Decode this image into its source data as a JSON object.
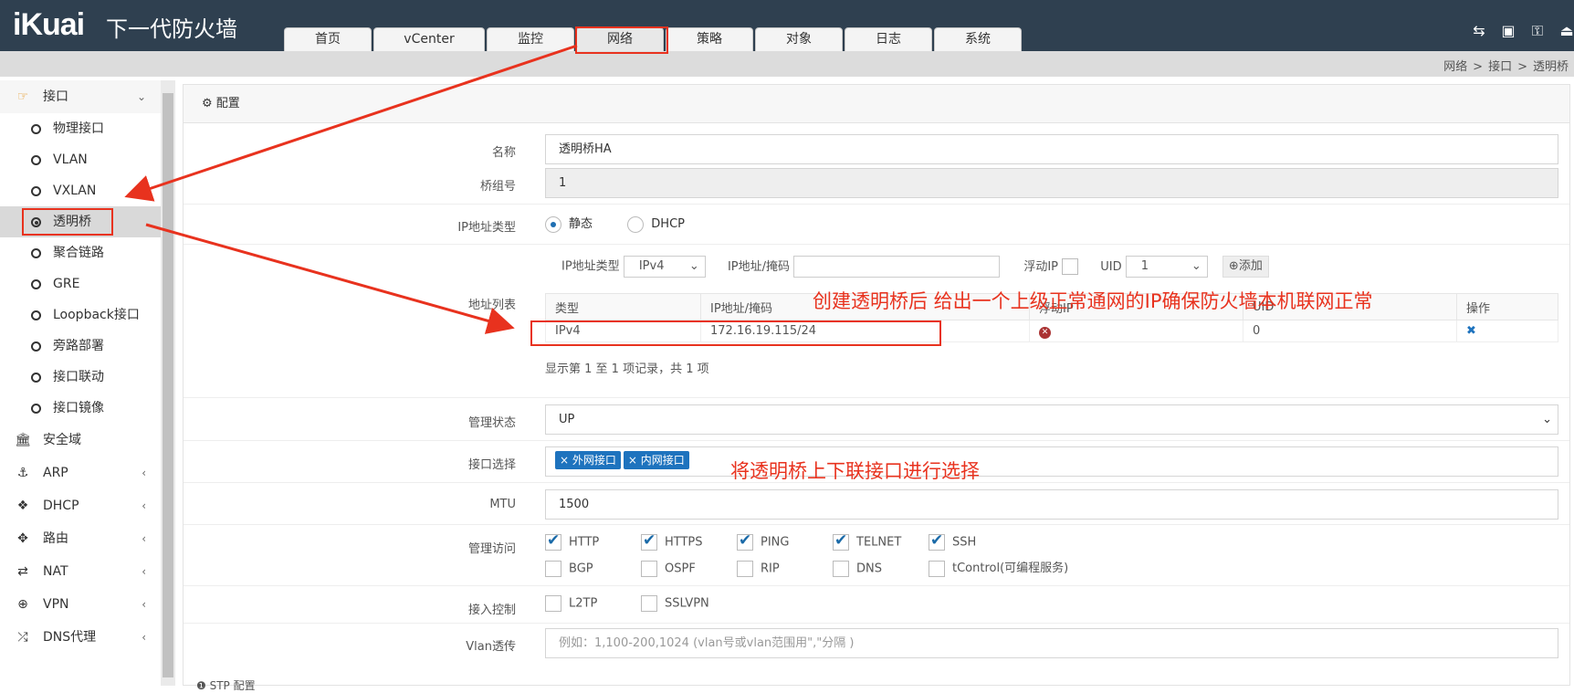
{
  "header": {
    "logo": "iKuai",
    "product": "下一代防火墙",
    "tabs": [
      "首页",
      "vCenter",
      "监控",
      "网络",
      "策略",
      "对象",
      "日志",
      "系统"
    ],
    "active_tab": "网络",
    "icons": [
      "translate-icon",
      "save-icon",
      "key-icon",
      "logout-icon"
    ]
  },
  "breadcrumb": [
    "网络",
    "接口",
    "透明桥"
  ],
  "breadcrumb_sep": ">",
  "sidebar": {
    "interface_group": "接口",
    "interface_items": [
      "物理接口",
      "VLAN",
      "VXLAN",
      "透明桥",
      "聚合链路",
      "GRE",
      "Loopback接口",
      "旁路部署",
      "接口联动",
      "接口镜像"
    ],
    "active_item": "透明桥",
    "groups": [
      {
        "label": "安全域",
        "icon": "bank-icon"
      },
      {
        "label": "ARP",
        "icon": "arp-icon"
      },
      {
        "label": "DHCP",
        "icon": "dhcp-icon"
      },
      {
        "label": "路由",
        "icon": "route-icon"
      },
      {
        "label": "NAT",
        "icon": "nat-icon"
      },
      {
        "label": "VPN",
        "icon": "vpn-icon"
      },
      {
        "label": "DNS代理",
        "icon": "shuffle-icon"
      }
    ]
  },
  "panel": {
    "title": "配置",
    "name_label": "名称",
    "name_value": "透明桥HA",
    "bridge_group_label": "桥组号",
    "bridge_group_value": "1",
    "ip_type_label": "IP地址类型",
    "ip_type_static": "静态",
    "ip_type_dhcp": "DHCP",
    "addr_row": {
      "ip_type_label": "IP地址类型",
      "ip_type_value": "IPv4",
      "ip_mask_label": "IP地址/掩码",
      "floating_label": "浮动IP",
      "uid_label": "UID",
      "uid_value": "1",
      "add_label": "添加"
    },
    "addr_list_label": "地址列表",
    "table": {
      "headers": [
        "类型",
        "IP地址/掩码",
        "浮动IP",
        "UID",
        "操作"
      ],
      "rows": [
        [
          "IPv4",
          "172.16.19.115/24",
          "",
          "0",
          ""
        ]
      ],
      "footer": "显示第 1 至 1 项记录，共 1 项"
    },
    "admin_state_label": "管理状态",
    "admin_state_value": "UP",
    "iface_select_label": "接口选择",
    "iface_tags": [
      "外网接口",
      "内网接口"
    ],
    "mtu_label": "MTU",
    "mtu_value": "1500",
    "mgmt_label": "管理访问",
    "mgmt_row1": [
      {
        "label": "HTTP",
        "checked": true
      },
      {
        "label": "HTTPS",
        "checked": true
      },
      {
        "label": "PING",
        "checked": true
      },
      {
        "label": "TELNET",
        "checked": true
      },
      {
        "label": "SSH",
        "checked": true
      }
    ],
    "mgmt_row2": [
      {
        "label": "BGP",
        "checked": false
      },
      {
        "label": "OSPF",
        "checked": false
      },
      {
        "label": "RIP",
        "checked": false
      },
      {
        "label": "DNS",
        "checked": false
      },
      {
        "label": "tControl(可编程服务)",
        "checked": false
      }
    ],
    "access_label": "接入控制",
    "access_items": [
      {
        "label": "L2TP",
        "checked": false
      },
      {
        "label": "SSLVPN",
        "checked": false
      }
    ],
    "vlan_label": "Vlan透传",
    "vlan_placeholder": "例如：1,100-200,1024 (vlan号或vlan范围用\",\"分隔 )",
    "stp_label": "STP 配置"
  },
  "annotations": {
    "addr_note": "创建透明桥后 给出一个上级正常通网的IP确保防火墙本机联网正常",
    "iface_note": "将透明桥上下联接口进行选择"
  },
  "colors": {
    "header_bg": "#2f4050",
    "annotation": "#e8321e",
    "tag": "#1e73be"
  }
}
